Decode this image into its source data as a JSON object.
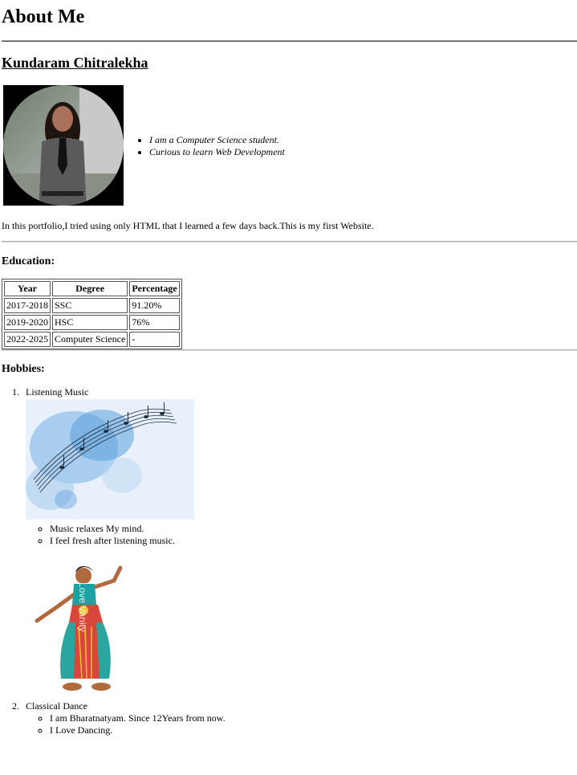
{
  "page": {
    "title": "About Me",
    "name": "Kundaram Chitralekha",
    "bio_points": [
      "I am a Computer Science student.",
      "Curious to learn Web Development"
    ],
    "intro": "In this portfolio,I tried using only HTML that I learned a few days back.This is my first Website."
  },
  "education": {
    "heading": "Education:",
    "columns": [
      "Year",
      "Degree",
      "Percentage"
    ],
    "rows": [
      [
        "2017-2018",
        "SSC",
        "91.20%"
      ],
      [
        "2019-2020",
        "HSC",
        "76%"
      ],
      [
        "2022-2025",
        "Computer Science",
        "-"
      ]
    ]
  },
  "hobbies": {
    "heading": "Hobbies:",
    "items": [
      {
        "number": "1.",
        "title": "Listening Music",
        "points": [
          "Music relaxes My mind.",
          "I feel fresh after listening music."
        ]
      },
      {
        "number": "2.",
        "title": "Classical Dance",
        "points": [
          "I am Bharatnatyam. Since 12Years from now.",
          "I Love Dancing."
        ]
      }
    ]
  },
  "images": {
    "profile_photo": "profile-photo",
    "music_image": "music-notes-watercolor",
    "dance_image": "bharatanatyam-dancer",
    "dance_watermark": "Love Vanity"
  }
}
